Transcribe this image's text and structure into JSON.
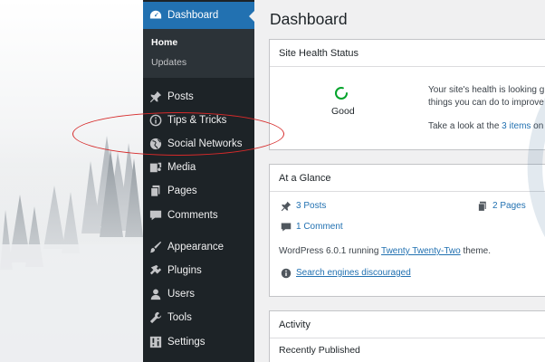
{
  "sidebar": {
    "active_item": "Dashboard",
    "submenu": [
      "Home",
      "Updates"
    ],
    "items": [
      {
        "label": "Posts",
        "icon": "pin-icon"
      },
      {
        "label": "Tips & Tricks",
        "icon": "info-icon"
      },
      {
        "label": "Social Networks",
        "icon": "globe-icon"
      },
      {
        "label": "Media",
        "icon": "media-icon"
      },
      {
        "label": "Pages",
        "icon": "pages-icon"
      },
      {
        "label": "Comments",
        "icon": "comment-icon"
      },
      {
        "label": "Appearance",
        "icon": "brush-icon"
      },
      {
        "label": "Plugins",
        "icon": "plugin-icon"
      },
      {
        "label": "Users",
        "icon": "user-icon"
      },
      {
        "label": "Tools",
        "icon": "wrench-icon"
      },
      {
        "label": "Settings",
        "icon": "settings-icon"
      }
    ]
  },
  "main": {
    "title": "Dashboard",
    "site_health": {
      "title": "Site Health Status",
      "status": "Good",
      "line1": "Your site's health is looking g",
      "line2": "things you can do to improve",
      "line3_prefix": "Take a look at the ",
      "line3_link": "3 items",
      "line3_suffix": " on"
    },
    "at_a_glance": {
      "title": "At a Glance",
      "posts": "3 Posts",
      "pages": "2 Pages",
      "comments": "1 Comment",
      "version_prefix": "WordPress 6.0.1 running ",
      "theme_link": "Twenty Twenty-Two",
      "version_suffix": " theme.",
      "search_engines": "Search engines discouraged"
    },
    "activity": {
      "title": "Activity",
      "subtitle": "Recently Published"
    }
  },
  "colors": {
    "sidebar_bg": "#1d2327",
    "active_bg": "#2271b1",
    "link": "#2271b1",
    "annotation": "#d62a2a",
    "health_good": "#00a32a"
  }
}
